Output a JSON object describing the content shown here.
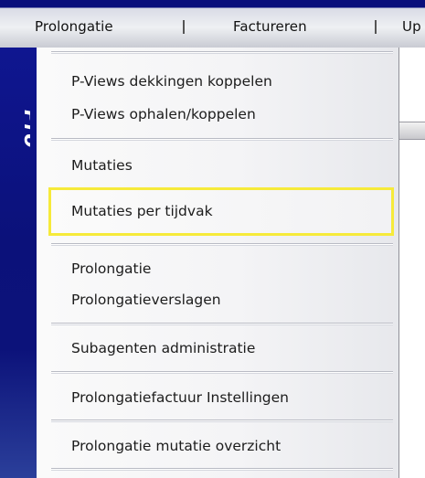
{
  "menubar": {
    "items": [
      {
        "label": "Prolongatie"
      },
      {
        "label": "Factureren"
      },
      {
        "label": "Up"
      }
    ]
  },
  "sidebar": {
    "brand": "Pro"
  },
  "dropdown": {
    "items": [
      {
        "label": "P-Views dekkingen koppelen"
      },
      {
        "label": "P-Views ophalen/koppelen"
      },
      {
        "label": "Mutaties"
      },
      {
        "label": "Mutaties per tijdvak",
        "highlighted": true
      },
      {
        "label": "Prolongatie"
      },
      {
        "label": "Prolongatieverslagen"
      },
      {
        "label": "Subagenten administratie"
      },
      {
        "label": "Prolongatiefactuur Instellingen"
      },
      {
        "label": "Prolongatie mutatie overzicht"
      }
    ]
  },
  "colors": {
    "stripe": "#0b117a",
    "highlight_border": "#f6ea3a",
    "menubar_accent": "#0a0f7c"
  }
}
